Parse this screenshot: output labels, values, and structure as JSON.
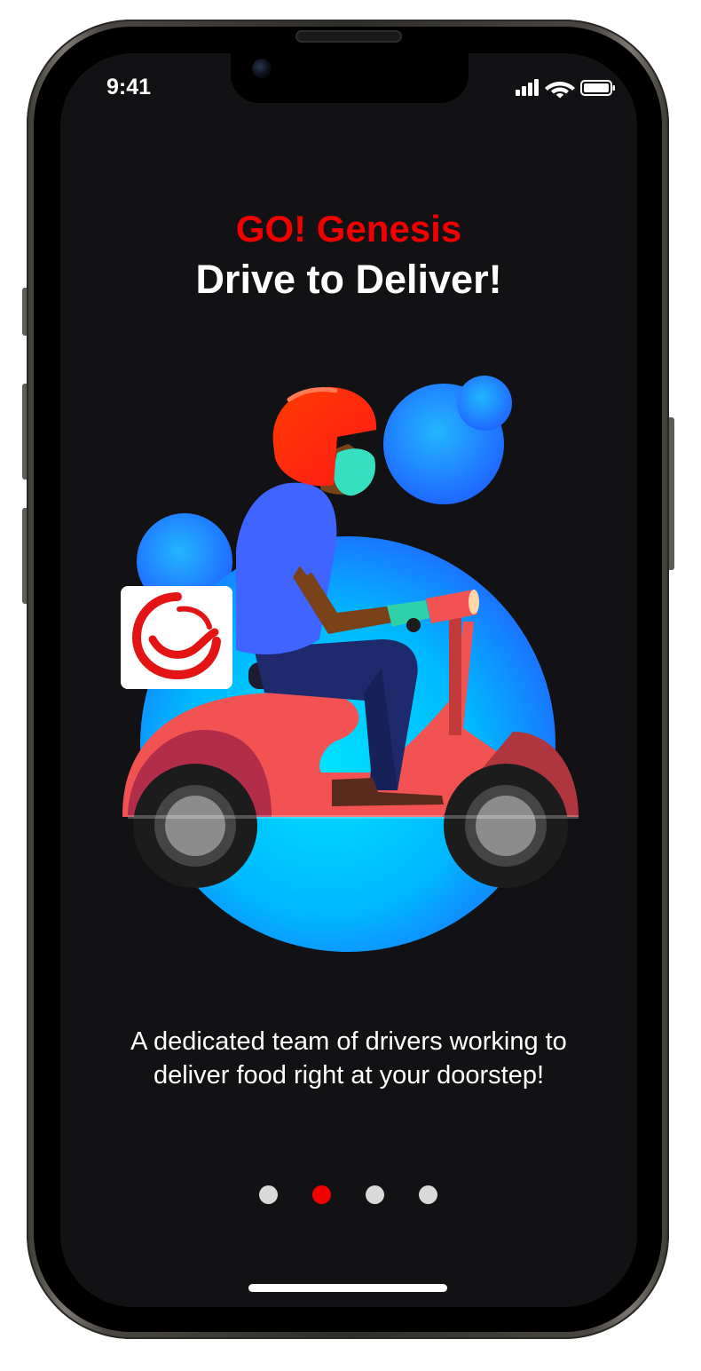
{
  "status_bar": {
    "time": "9:41",
    "icons": [
      "cellular-signal-icon",
      "wifi-icon",
      "battery-icon"
    ]
  },
  "onboarding": {
    "brand_title": "GO! Genesis",
    "headline": "Drive to Deliver!",
    "illustration": "delivery-rider-scooter-illustration",
    "description": "A dedicated team of drivers working to deliver food right at your doorstep!",
    "page_indicator": {
      "total": 4,
      "current": 2
    }
  },
  "colors": {
    "background": "#121214",
    "brand_red": "#f10000",
    "text": "#ffffff",
    "dot_inactive": "#d9d9d9",
    "blob_blue": "#1aa7ff",
    "scooter_red": "#f25252"
  }
}
